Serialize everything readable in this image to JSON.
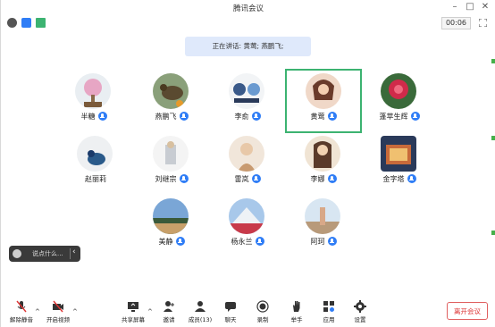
{
  "window": {
    "title": "腾讯会议",
    "timer": "00:06"
  },
  "speaking": {
    "text": "正在讲话: 黄莺; 燕鹏飞;"
  },
  "participants": [
    {
      "name": "半糖",
      "mic": "mic-on"
    },
    {
      "name": "燕鹏飞",
      "mic": "mic-on"
    },
    {
      "name": "李俞",
      "mic": "mic-on"
    },
    {
      "name": "黄莺",
      "mic": "mic-on",
      "active": true
    },
    {
      "name": "蓬苹生辉",
      "mic": "mic-on"
    },
    {
      "name": "赵丽莉",
      "mic": "none"
    },
    {
      "name": "刘继宗",
      "mic": "mic-on"
    },
    {
      "name": "雷岚",
      "mic": "mic-on"
    },
    {
      "name": "李娜",
      "mic": "mic-on"
    },
    {
      "name": "金字塔",
      "mic": "mic-on"
    },
    {
      "name": "美静",
      "mic": "mic-on"
    },
    {
      "name": "杨永兰",
      "mic": "mic-on"
    },
    {
      "name": "阿珂",
      "mic": "mic-on"
    }
  ],
  "chat_popup": {
    "placeholder": "说点什么..."
  },
  "toolbar": {
    "unmute": "解除静音",
    "start_video": "开启视频",
    "share_screen": "共享屏幕",
    "invite": "邀请",
    "members": "成员(13)",
    "chat": "聊天",
    "record": "录制",
    "raise_hand": "举手",
    "apps": "应用",
    "settings": "设置"
  },
  "leave_button": "离开会议",
  "colors": {
    "accent": "#2f7df6",
    "active_border": "#3cb371",
    "leave": "#e06060"
  }
}
